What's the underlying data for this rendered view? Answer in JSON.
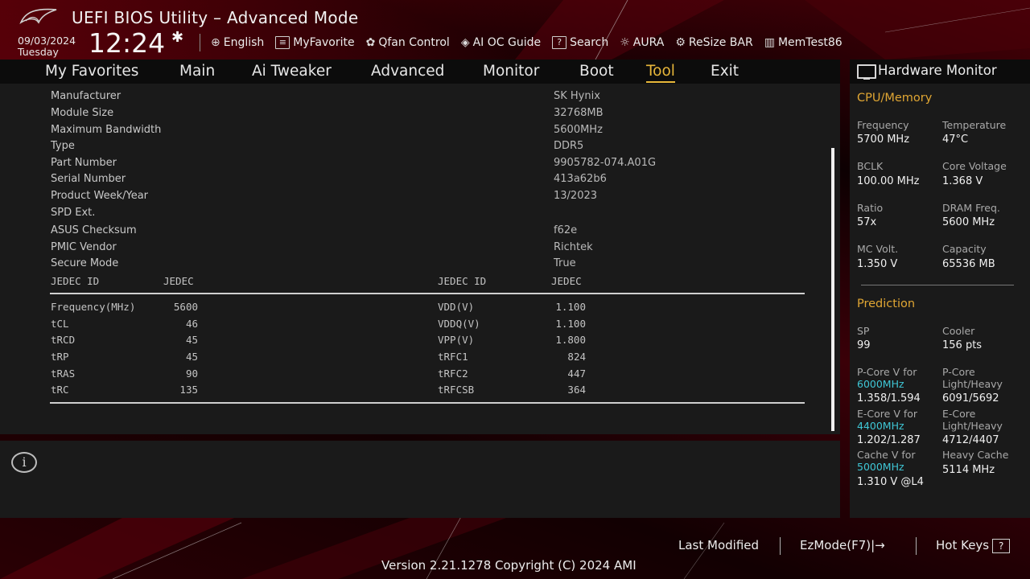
{
  "header": {
    "title": "UEFI BIOS Utility – Advanced Mode",
    "date": "09/03/2024",
    "day": "Tuesday",
    "time": "12:24"
  },
  "toolbar": {
    "items": [
      {
        "label": "English",
        "icon": "globe-icon"
      },
      {
        "label": "MyFavorite",
        "icon": "favorite-icon"
      },
      {
        "label": "Qfan Control",
        "icon": "fan-icon"
      },
      {
        "label": "AI OC Guide",
        "icon": "ai-oc-guide-icon"
      },
      {
        "label": "Search",
        "icon": "search-icon"
      },
      {
        "label": "AURA",
        "icon": "aura-icon"
      },
      {
        "label": "ReSize BAR",
        "icon": "resize-bar-icon"
      },
      {
        "label": "MemTest86",
        "icon": "memtest-icon"
      }
    ]
  },
  "menu": {
    "items": [
      "My Favorites",
      "Main",
      "Ai Tweaker",
      "Advanced",
      "Monitor",
      "Boot",
      "Tool",
      "Exit"
    ],
    "active": "Tool"
  },
  "spd": {
    "rows": [
      {
        "label": "Manufacturer",
        "value": "SK Hynix"
      },
      {
        "label": "Module Size",
        "value": "32768MB"
      },
      {
        "label": "Maximum Bandwidth",
        "value": "5600MHz"
      },
      {
        "label": "Type",
        "value": "DDR5"
      },
      {
        "label": "Part Number",
        "value": "9905782-074.A01G"
      },
      {
        "label": "Serial Number",
        "value": "413a62b6"
      },
      {
        "label": "Product Week/Year",
        "value": "13/2023"
      },
      {
        "label": "SPD Ext.",
        "value": ""
      },
      {
        "label": "ASUS Checksum",
        "value": "f62e"
      },
      {
        "label": "PMIC Vendor",
        "value": "Richtek"
      },
      {
        "label": "Secure Mode",
        "value": "True"
      }
    ],
    "table_header": {
      "left_id": "JEDEC ID",
      "left_val": "JEDEC",
      "right_id": "JEDEC ID",
      "right_val": "JEDEC"
    },
    "left_timings": [
      {
        "name": "Frequency(MHz)",
        "value": "5600"
      },
      {
        "name": "tCL",
        "value": "46"
      },
      {
        "name": "tRCD",
        "value": "45"
      },
      {
        "name": "tRP",
        "value": "45"
      },
      {
        "name": "tRAS",
        "value": "90"
      },
      {
        "name": "tRC",
        "value": "135"
      }
    ],
    "right_timings": [
      {
        "name": "VDD(V)",
        "value": "1.100"
      },
      {
        "name": "VDDQ(V)",
        "value": "1.100"
      },
      {
        "name": "VPP(V)",
        "value": "1.800"
      },
      {
        "name": "tRFC1",
        "value": "824"
      },
      {
        "name": "tRFC2",
        "value": "447"
      },
      {
        "name": "tRFCSB",
        "value": "364"
      }
    ]
  },
  "hw": {
    "title": "Hardware Monitor",
    "cpu_section": "CPU/Memory",
    "cpu": [
      {
        "label": "Frequency",
        "value": "5700 MHz"
      },
      {
        "label": "Temperature",
        "value": "47°C"
      },
      {
        "label": "BCLK",
        "value": "100.00 MHz"
      },
      {
        "label": "Core Voltage",
        "value": "1.368 V"
      },
      {
        "label": "Ratio",
        "value": "57x"
      },
      {
        "label": "DRAM Freq.",
        "value": "5600 MHz"
      },
      {
        "label": "MC Volt.",
        "value": "1.350 V"
      },
      {
        "label": "Capacity",
        "value": "65536 MB"
      }
    ],
    "prediction_section": "Prediction",
    "sp_label": "SP",
    "sp_value": "99",
    "cooler_label": "Cooler",
    "cooler_value": "156 pts",
    "pcore_label": "P-Core V for",
    "pcore_freq": "6000MHz",
    "pcore_value": "1.358/1.594",
    "pcore_lh_label1": "P-Core",
    "pcore_lh_label2": "Light/Heavy",
    "pcore_lh_value": "6091/5692",
    "ecore_label": "E-Core V for",
    "ecore_freq": "4400MHz",
    "ecore_value": "1.202/1.287",
    "ecore_lh_label1": "E-Core",
    "ecore_lh_label2": "Light/Heavy",
    "ecore_lh_value": "4712/4407",
    "cache_label": "Cache V for",
    "cache_freq": "5000MHz",
    "cache_value": "1.310 V @L4",
    "heavy_cache_label": "Heavy Cache",
    "heavy_cache_value": "5114 MHz"
  },
  "footer": {
    "last_modified": "Last Modified",
    "ezmode": "EzMode(F7)|",
    "hotkeys": "Hot Keys",
    "hotkeys_glyph": "?",
    "version": "Version 2.21.1278 Copyright (C) 2024 AMI"
  },
  "colors": {
    "accent": "#e8b73a",
    "highlight": "#3fc7d6",
    "panel": "#1a1a1a",
    "background": "#2a0004"
  }
}
